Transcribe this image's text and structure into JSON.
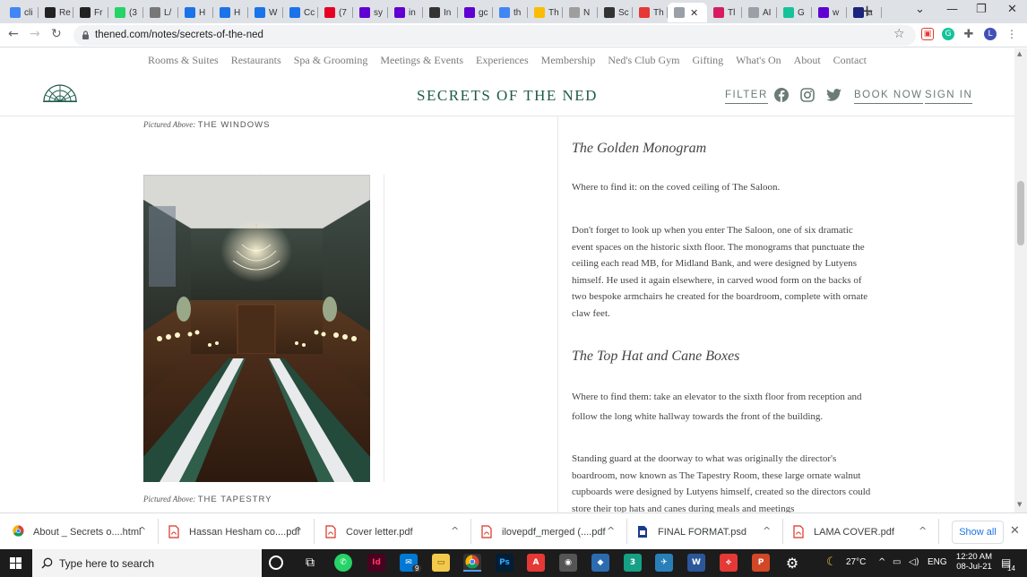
{
  "browser": {
    "tabs": [
      {
        "label": "cli",
        "icon": "google-icon",
        "color": "#4285f4"
      },
      {
        "label": "Re",
        "icon": "cad-icon",
        "color": "#222"
      },
      {
        "label": "Fr",
        "icon": "fr-icon",
        "color": "#222"
      },
      {
        "label": "(3",
        "icon": "whatsapp-icon",
        "color": "#25d366"
      },
      {
        "label": "L/",
        "icon": "link-icon",
        "color": "#777"
      },
      {
        "label": "H",
        "icon": "g-icon",
        "color": "#1a73e8"
      },
      {
        "label": "H",
        "icon": "g-icon",
        "color": "#1a73e8"
      },
      {
        "label": "W",
        "icon": "g-icon",
        "color": "#1a73e8"
      },
      {
        "label": "Cc",
        "icon": "g-icon",
        "color": "#1a73e8"
      },
      {
        "label": "(7",
        "icon": "pinterest-icon",
        "color": "#e60023"
      },
      {
        "label": "sy",
        "icon": "yahoo-icon",
        "color": "#6001d2"
      },
      {
        "label": "in",
        "icon": "yahoo-icon",
        "color": "#6001d2"
      },
      {
        "label": "In",
        "icon": "sow-icon",
        "color": "#333"
      },
      {
        "label": "gc",
        "icon": "yahoo-icon",
        "color": "#6001d2"
      },
      {
        "label": "th",
        "icon": "google-icon",
        "color": "#4285f4"
      },
      {
        "label": "Th",
        "icon": "yellow-icon",
        "color": "#fbbc04"
      },
      {
        "label": "N",
        "icon": "n-icon",
        "color": "#9e9e9e"
      },
      {
        "label": "Sc",
        "icon": "sc-icon",
        "color": "#333"
      },
      {
        "label": "Th",
        "icon": "th-icon",
        "color": "#e53935"
      },
      {
        "label": "",
        "icon": "cloud-icon",
        "color": "#9aa0a6",
        "active": true
      },
      {
        "label": "Tl",
        "icon": "ec-icon",
        "color": "#d81b60"
      },
      {
        "label": "AI",
        "icon": "cloud-icon",
        "color": "#9aa0a6"
      },
      {
        "label": "G",
        "icon": "grammarly-icon",
        "color": "#15c39a"
      },
      {
        "label": "w",
        "icon": "yahoo-icon",
        "color": "#6001d2"
      },
      {
        "label": "a",
        "icon": "grid-icon",
        "color": "#1a237e"
      }
    ],
    "url": "thened.com/notes/secrets-of-the-ned"
  },
  "site": {
    "nav": [
      "Rooms & Suites",
      "Restaurants",
      "Spa & Grooming",
      "Meetings & Events",
      "Experiences",
      "Membership",
      "Ned's Club Gym",
      "Gifting",
      "What's On",
      "About",
      "Contact"
    ],
    "title": "SECRETS OF THE NED",
    "filter": "FILTER",
    "book_now": "BOOK NOW",
    "sign_in": "SIGN IN"
  },
  "captions": {
    "prefix": "Pictured Above:",
    "top": "THE WINDOWS",
    "bottom": "THE TAPESTRY"
  },
  "article": {
    "h1": "The Golden Monogram",
    "p1": "Where to find it: on the coved ceiling of The Saloon.",
    "p2": "Don't forget to look up when you enter The Saloon, one of six dramatic event spaces on the historic sixth floor. The monograms that punctuate the ceiling each read MB, for Midland Bank, and were designed by Lutyens himself. He used it again elsewhere, in carved wood form on the backs of two bespoke armchairs he created for the boardroom, complete with ornate claw feet.",
    "h2": "The Top Hat and Cane Boxes",
    "p3": "Where to find them: take an elevator to the sixth floor from reception and follow the long white hallway towards the front of the building.",
    "p4": "Standing guard at the doorway to what was originally the director's boardroom, now known as The Tapestry Room, these large ornate walnut cupboards were designed by Lutyens himself, created so the directors could store their top hats and canes during meals and meetings"
  },
  "downloads": {
    "items": [
      {
        "name": "About _ Secrets o....html",
        "icon": "chrome-icon"
      },
      {
        "name": "Hassan Hesham co....pdf",
        "icon": "pdf-icon"
      },
      {
        "name": "Cover letter.pdf",
        "icon": "pdf-icon"
      },
      {
        "name": "ilovepdf_merged (....pdf",
        "icon": "pdf-icon"
      },
      {
        "name": "FINAL FORMAT.psd",
        "icon": "file-icon"
      },
      {
        "name": "LAMA COVER.pdf",
        "icon": "pdf-icon"
      }
    ],
    "show_all": "Show all"
  },
  "taskbar": {
    "search_placeholder": "Type here to search",
    "weather": "27°C",
    "lang": "ENG",
    "time": "12:20 AM",
    "date": "08-Jul-21",
    "notifications": "14",
    "mail_badge": "9"
  }
}
